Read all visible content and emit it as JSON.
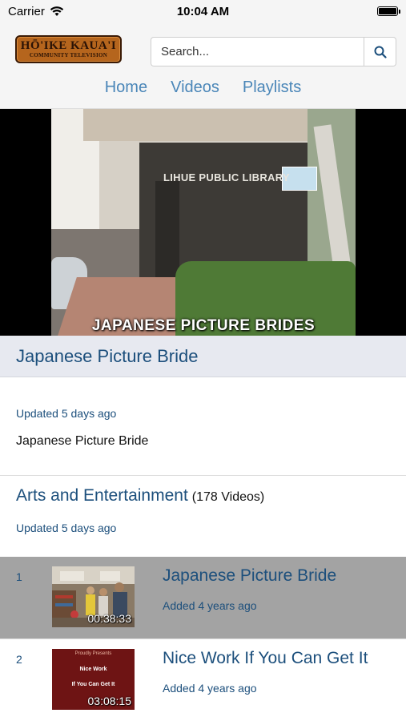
{
  "status_bar": {
    "carrier": "Carrier",
    "time": "10:04 AM"
  },
  "header": {
    "logo_line1": "HŌ'IKE KAUA'I",
    "logo_line2": "COMMUNITY TELEVISION",
    "search_placeholder": "Search...",
    "nav": [
      "Home",
      "Videos",
      "Playlists"
    ]
  },
  "video": {
    "sign_text": "LIHUE PUBLIC LIBRARY",
    "caption": "JAPANESE PICTURE BRIDES"
  },
  "current": {
    "title": "Japanese Picture Bride",
    "updated": "Updated 5 days ago",
    "description": "Japanese Picture Bride"
  },
  "playlist": {
    "name": "Arts and Entertainment",
    "count": "(178 Videos)",
    "updated": "Updated 5 days ago",
    "items": [
      {
        "num": "1",
        "title": "Japanese Picture Bride",
        "duration": "00:38:33",
        "added": "Added 4 years ago",
        "active": true
      },
      {
        "num": "2",
        "title": "Nice Work If You Can Get It",
        "duration": "03:08:15",
        "added": "Added 4 years ago",
        "active": false
      }
    ]
  },
  "thumb2_text": {
    "line1": "Proudly Presents",
    "line2": "Nice Work",
    "line3": "If You Can Get It"
  }
}
